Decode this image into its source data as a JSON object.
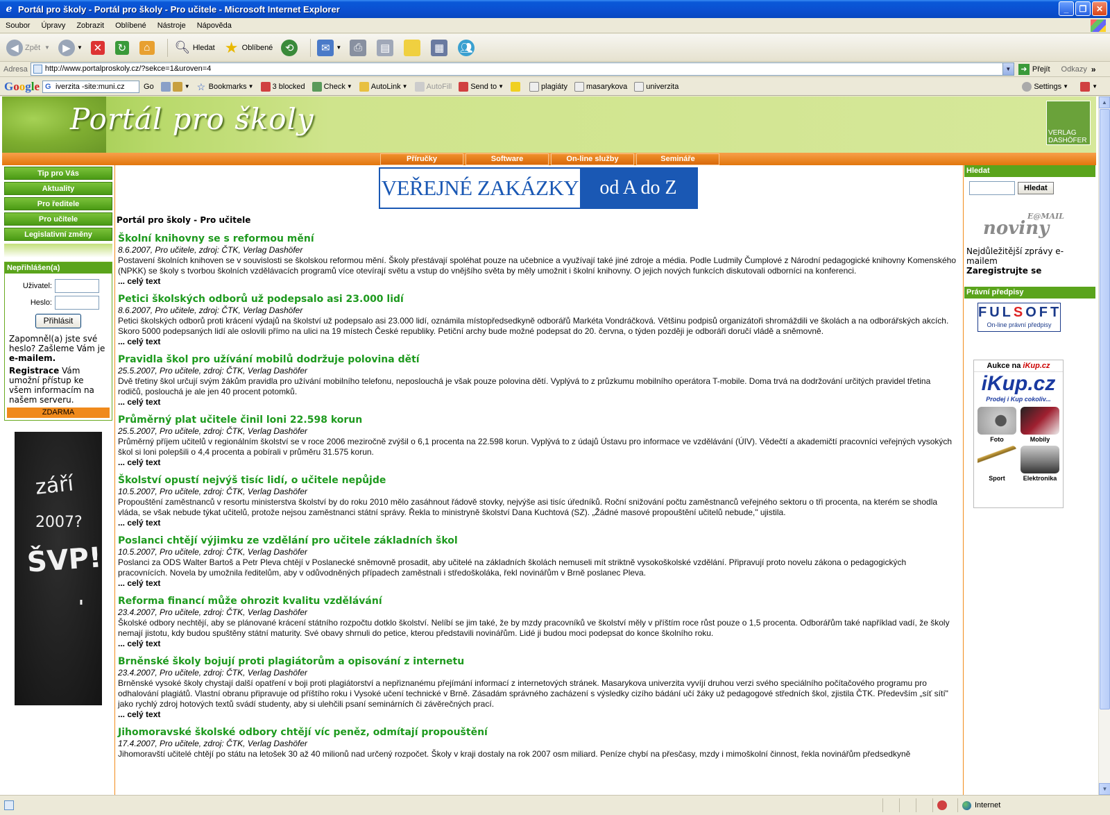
{
  "window": {
    "title": "Portál pro školy - Portál pro školy - Pro učitele - Microsoft Internet Explorer"
  },
  "menu": [
    "Soubor",
    "Úpravy",
    "Zobrazit",
    "Oblíbené",
    "Nástroje",
    "Nápověda"
  ],
  "toolbar": {
    "back": "Zpět",
    "search": "Hledat",
    "favorites": "Oblíbené"
  },
  "address": {
    "label": "Adresa",
    "url": "http://www.portalproskoly.cz/?sekce=1&uroven=4",
    "go": "Přejít",
    "links": "Odkazy"
  },
  "googlebar": {
    "logo": "Google",
    "query": "iverzita -site:muni.cz",
    "go": "Go",
    "bookmarks": "Bookmarks",
    "blocked": "3 blocked",
    "check": "Check",
    "autolink": "AutoLink",
    "autofill": "AutoFill",
    "sendto": "Send to",
    "terms": [
      "plagiáty",
      "masarykova",
      "univerzita"
    ],
    "settings": "Settings"
  },
  "site": {
    "logo": "Portál pro školy",
    "publisher": "VERLAG DASHÖFER",
    "nav": [
      "Příručky",
      "Software",
      "On-line služby",
      "Semináře"
    ]
  },
  "left": {
    "menu": [
      "Tip pro Vás",
      "Aktuality",
      "Pro ředitele",
      "Pro učitele",
      "Legislativní změny"
    ],
    "login": {
      "heading": "Nepřihlášen(a)",
      "user_label": "Uživatel:",
      "pass_label": "Heslo:",
      "button": "Přihlásit",
      "forgot": "Zapomněl(a) jste své heslo? Zašleme Vám je",
      "forgot_bold": "e-mailem.",
      "reg_bold": "Registrace",
      "reg": "Vám umožní přístup ke všem informacím na našem serveru.",
      "free": "ZDARMA"
    },
    "ad": {
      "line1": "září",
      "line2": "2007?",
      "line3": "ŠVP!",
      "line4": "'"
    }
  },
  "main": {
    "banner_left": "VEŘEJNÉ ZAKÁZKY",
    "banner_right": "od A do Z",
    "page_heading": "Portál pro školy - Pro učitele",
    "more_label": "... celý text",
    "articles": [
      {
        "title": "Školní knihovny se s reformou mění",
        "meta": "8.6.2007, Pro učitele, zdroj: ČTK, Verlag Dashöfer",
        "desc": "Postavení školních knihoven se v souvislosti se školskou reformou mění. Školy přestávají spoléhat pouze na učebnice a využívají také jiné zdroje a média. Podle Ludmily Čumplové z Národní pedagogické knihovny Komenského (NPKK) se školy s tvorbou školních vzdělávacích programů více otevírají světu a vstup do vnějšího světa by měly umožnit i školní knihovny. O jejich nových funkcích diskutovali odborníci na konferenci."
      },
      {
        "title": "Petici školských odborů už podepsalo asi 23.000 lidí",
        "meta": "8.6.2007, Pro učitele, zdroj: ČTK, Verlag Dashöfer",
        "desc": "Petici školských odborů proti krácení výdajů na školství už podepsalo asi 23.000 lidí, oznámila místopředsedkyně odborářů Markéta Vondráčková. Většinu podpisů organizátoři shromáždili ve školách a na odborářských akcích. Skoro 5000 podepsaných lidí ale oslovili přímo na ulici na 19 místech České republiky. Petiční archy bude možné podepsat do 20. června, o týden později je odboráři doručí vládě a sněmovně."
      },
      {
        "title": "Pravidla škol pro užívání mobilů dodržuje polovina dětí",
        "meta": "25.5.2007, Pro učitele, zdroj: ČTK, Verlag Dashöfer",
        "desc": "Dvě třetiny škol určují svým žákům pravidla pro užívání mobilního telefonu, neposlouchá je však pouze polovina dětí. Vyplývá to z průzkumu mobilního operátora T-mobile. Doma trvá na dodržování určitých pravidel třetina rodičů, poslouchá je ale jen 40 procent potomků."
      },
      {
        "title": "Průměrný plat učitele činil loni 22.598 korun",
        "meta": "25.5.2007, Pro učitele, zdroj: ČTK, Verlag Dashöfer",
        "desc": "Průměrný příjem učitelů v regionálním školství se v roce 2006 meziročně zvýšil o 6,1 procenta na 22.598 korun. Vyplývá to z údajů Ústavu pro informace ve vzdělávání (ÚIV). Vědečtí a akademičtí pracovníci veřejných vysokých škol si loni polepšili o 4,4 procenta a pobírali v průměru 31.575 korun."
      },
      {
        "title": "Školství opustí nejvýš tisíc lidí, o učitele nepůjde",
        "meta": "10.5.2007, Pro učitele, zdroj: ČTK, Verlag Dashöfer",
        "desc": "Propouštění zaměstnanců v resortu ministerstva školství by do roku 2010 mělo zasáhnout řádově stovky, nejvýše asi tisíc úředníků. Roční snižování počtu zaměstnanců veřejného sektoru o tři procenta, na kterém se shodla vláda, se však nebude týkat učitelů, protože nejsou zaměstnanci státní správy. Řekla to ministryně školství Dana Kuchtová (SZ). „Žádné masové propouštění učitelů nebude,\" ujistila."
      },
      {
        "title": "Poslanci chtějí výjimku ze vzdělání pro učitele základních škol",
        "meta": "10.5.2007, Pro učitele, zdroj: ČTK, Verlag Dashöfer",
        "desc": "Poslanci za ODS Walter Bartoš a Petr Pleva chtějí v Poslanecké sněmovně prosadit, aby učitelé na základních školách nemuseli mít striktně vysokoškolské vzdělání. Připravují proto novelu zákona o pedagogických pracovnících. Novela by umožnila ředitelům, aby v odůvodněných případech zaměstnali i středoškoláka, řekl novinářům v Brně poslanec Pleva."
      },
      {
        "title": "Reforma financí může ohrozit kvalitu vzdělávání",
        "meta": "23.4.2007, Pro učitele, zdroj: ČTK, Verlag Dashöfer",
        "desc": "Školské odbory nechtějí, aby se plánované krácení státního rozpočtu dotklo školství. Nelíbí se jim také, že by mzdy pracovníků ve školství měly v příštím roce růst pouze o 1,5 procenta. Odborářům také například vadí, že školy nemají jistotu, kdy budou spuštěny státní maturity. Své obavy shrnuli do petice, kterou představili novinářům. Lidé ji budou moci podepsat do konce školního roku."
      },
      {
        "title": "Brněnské školy bojují proti plagiátorům a opisování z internetu",
        "meta": "23.4.2007, Pro učitele, zdroj: ČTK, Verlag Dashöfer",
        "desc": "Brněnské vysoké školy chystají další opatření v boji proti plagiátorství a nepřiznanému přejímání informací z internetových stránek. Masarykova univerzita vyvíjí druhou verzi svého speciálního počítačového programu pro odhalování plagiátů. Vlastní obranu připravuje od příštího roku i Vysoké učení technické v Brně. Zásadám správného zacházení s výsledky cizího bádání učí žáky už pedagogové středních škol, zjistila ČTK. Především „síť sítí\" jako rychlý zdroj hotových textů svádí studenty, aby si ulehčili psaní seminárních či závěrečných prací."
      },
      {
        "title": "Jihomoravské školské odbory chtějí víc peněz, odmítají propouštění",
        "meta": "17.4.2007, Pro učitele, zdroj: ČTK, Verlag Dashöfer",
        "desc": "Jihomoravští učitelé chtějí po státu na letošek 30 až 40 milionů nad určený rozpočet. Školy v kraji dostaly na rok 2007 osm miliard. Peníze chybí na přesčasy, mzdy i mimoškolní činnost, řekla novinářům předsedkyně"
      }
    ]
  },
  "right": {
    "search_heading": "Hledat",
    "search_button": "Hledat",
    "enews_small": "E@MAIL",
    "enews_big": "noviny",
    "enews_text": "Nejdůležitější zprávy e-mailem",
    "enews_cta": "Zaregistrujte se",
    "law_heading": "Právní předpisy",
    "fulsoft_a": "FUL",
    "fulsoft_b": "S",
    "fulsoft_c": "OFT",
    "fulsoft_sub": "On-line právní předpisy",
    "ikup_head": "Aukce na",
    "ikup_head_brand": "iKup.cz",
    "ikup_logo_a": "iKup",
    "ikup_logo_b": ".cz",
    "ikup_tag": "Prodej i Kup cokoliv...",
    "ikup_items": [
      "Foto",
      "Mobily",
      "Sport",
      "Elektronika"
    ]
  },
  "status": {
    "zone": "Internet"
  }
}
